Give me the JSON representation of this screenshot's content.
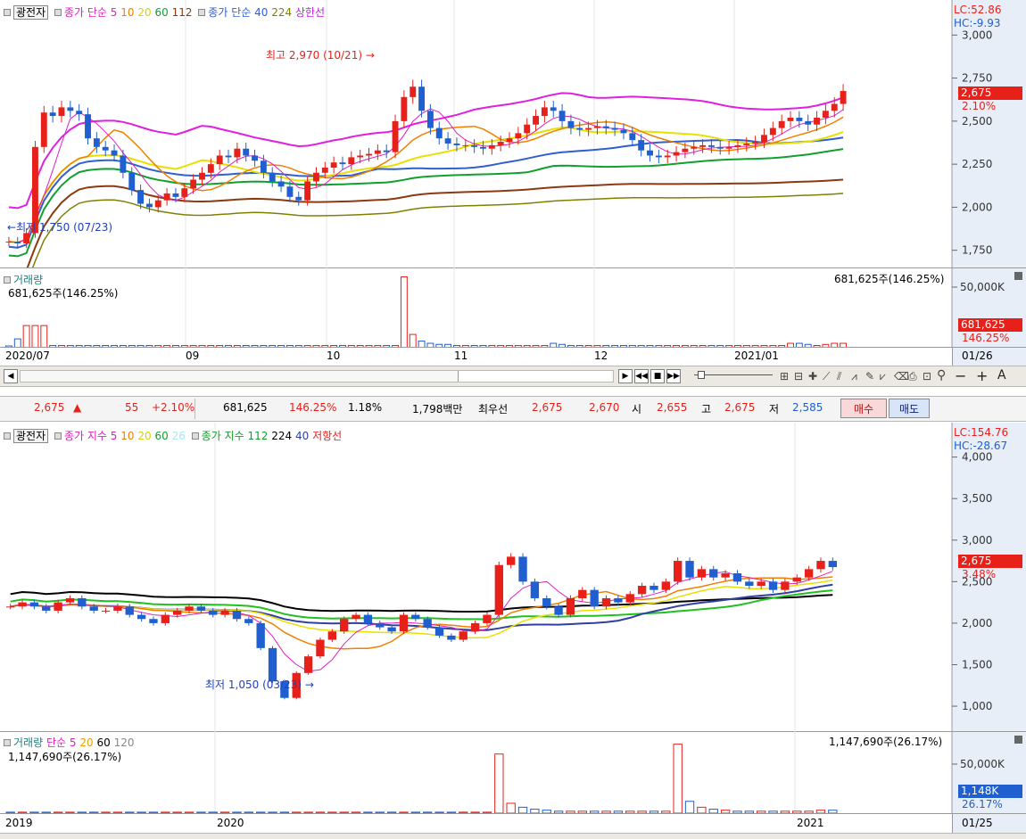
{
  "upper": {
    "stock_name": "광전자",
    "legend_close_label": "종가 단순",
    "legend_periods": [
      "5",
      "10",
      "20",
      "60",
      "112"
    ],
    "legend_close_label2": "종가 단순",
    "legend_periods2": [
      "40",
      "224"
    ],
    "legend_extra": "상한선",
    "lc": "LC:52.86",
    "hc": "HC:-9.93",
    "y_ticks": [
      "3,000",
      "2,750",
      "2,500",
      "2,250",
      "2,000",
      "1,750"
    ],
    "price_badge": "2,675",
    "pct_badge": "2.10%",
    "high_annotation": "최고 2,970 (10/21)",
    "low_annotation": "최저 1,750 (07/23)",
    "volume_title": "거래량",
    "volume_value": "681,625주(146.25%)",
    "volume_value_right": "681,625주(146.25%)",
    "vol_tick": "50,000K",
    "vol_badge": "681,625",
    "vol_pct": "146.25%",
    "x_labels": [
      "2020/07",
      "09",
      "10",
      "11",
      "12",
      "2021/01"
    ],
    "date_badge": "01/26"
  },
  "quote": {
    "price": "2,675",
    "arrow": "▲",
    "change": "55",
    "change_pct": "+2.10%",
    "volume": "681,625",
    "vol_pct": "146.25%",
    "turnover": "1.18%",
    "amount": "1,798백만",
    "best_label": "최우선",
    "ask": "2,675",
    "bid": "2,670",
    "open_label": "시",
    "open": "2,655",
    "high_label": "고",
    "high": "2,675",
    "low_label": "저",
    "low": "2,585",
    "buy": "매수",
    "sell": "매도"
  },
  "lower": {
    "stock_name": "광전자",
    "legend_label": "종가 지수",
    "legend_periods": [
      "5",
      "10",
      "20",
      "60",
      "26"
    ],
    "legend_label2": "종가 지수",
    "legend_periods2": [
      "112",
      "224",
      "40"
    ],
    "legend_extra": "저항선",
    "lc": "LC:154.76",
    "hc": "HC:-28.67",
    "y_ticks": [
      "4,000",
      "3,500",
      "3,000",
      "2,500",
      "2,000",
      "1,500",
      "1,000"
    ],
    "price_badge": "2,675",
    "pct_badge": "3.48%",
    "low_annotation": "최저 1,050 (03/23)",
    "volume_title": "거래량",
    "vol_legend_label": "단순",
    "vol_periods": [
      "5",
      "20",
      "60",
      "120"
    ],
    "volume_value": "1,147,690주(26.17%)",
    "volume_value_right": "1,147,690주(26.17%)",
    "vol_tick": "50,000K",
    "vol_badge": "1,148K",
    "vol_pct": "26.17%",
    "x_labels": [
      "2019",
      "2020",
      "2021"
    ],
    "date_badge": "01/25"
  },
  "toolbar": {
    "letter_a": "A",
    "minus": "−",
    "plus": "+"
  },
  "colors": {
    "up": "#e8201a",
    "down": "#1f5fd0",
    "ma5": "#e020c0",
    "ma10": "#f08000",
    "ma20": "#e8e000",
    "ma60": "#10a030",
    "ma112": "#8b3a10",
    "ma40": "#3060d0",
    "ma224": "#808000"
  },
  "chart_data": [
    {
      "type": "candlestick",
      "title": "광전자",
      "y_range": [
        1650,
        3100
      ],
      "x_categories": [
        "2020/07",
        "09",
        "10",
        "11",
        "12",
        "2021/01"
      ],
      "highest": {
        "value": 2970,
        "date": "10/21"
      },
      "lowest": {
        "value": 1750,
        "date": "07/23"
      },
      "last": 2675,
      "closes": [
        1800,
        1790,
        1850,
        2350,
        2550,
        2530,
        2580,
        2560,
        2540,
        2400,
        2350,
        2330,
        2300,
        2200,
        2100,
        2020,
        2000,
        2040,
        2080,
        2060,
        2110,
        2160,
        2200,
        2250,
        2300,
        2290,
        2340,
        2300,
        2270,
        2200,
        2150,
        2120,
        2060,
        2040,
        2150,
        2200,
        2230,
        2260,
        2250,
        2290,
        2300,
        2310,
        2330,
        2320,
        2500,
        2640,
        2700,
        2560,
        2460,
        2400,
        2370,
        2360,
        2360,
        2350,
        2340,
        2360,
        2380,
        2400,
        2430,
        2480,
        2530,
        2580,
        2560,
        2500,
        2460,
        2450,
        2460,
        2470,
        2460,
        2450,
        2430,
        2390,
        2330,
        2300,
        2290,
        2300,
        2320,
        2340,
        2350,
        2360,
        2350,
        2340,
        2350,
        2360,
        2370,
        2380,
        2420,
        2460,
        2500,
        2520,
        2500,
        2480,
        2520,
        2560,
        2600,
        2675
      ],
      "volumes": [
        8,
        40,
        100,
        100,
        100,
        10,
        10,
        10,
        10,
        10,
        10,
        10,
        10,
        10,
        10,
        10,
        10,
        10,
        10,
        10,
        10,
        10,
        10,
        10,
        10,
        10,
        10,
        10,
        10,
        10,
        10,
        10,
        10,
        10,
        10,
        10,
        10,
        10,
        10,
        10,
        10,
        10,
        10,
        10,
        10,
        320,
        60,
        30,
        20,
        15,
        15,
        10,
        10,
        10,
        10,
        10,
        10,
        10,
        10,
        10,
        10,
        10,
        20,
        15,
        10,
        10,
        10,
        10,
        10,
        10,
        10,
        10,
        10,
        10,
        10,
        10,
        10,
        10,
        10,
        10,
        10,
        10,
        10,
        10,
        10,
        10,
        10,
        10,
        10,
        20,
        20,
        15,
        10,
        15,
        20,
        20
      ]
    },
    {
      "type": "candlestick",
      "title": "광전자",
      "y_range": [
        700,
        4200
      ],
      "x_categories": [
        "2019",
        "2020",
        "2021"
      ],
      "lowest": {
        "value": 1050,
        "date": "03/23"
      },
      "last": 2675,
      "closes": [
        2200,
        2250,
        2200,
        2150,
        2250,
        2300,
        2200,
        2150,
        2150,
        2200,
        2100,
        2050,
        2000,
        2100,
        2150,
        2200,
        2150,
        2100,
        2150,
        2050,
        2000,
        1700,
        1300,
        1100,
        1400,
        1600,
        1800,
        1900,
        2050,
        2100,
        2000,
        1950,
        1900,
        2100,
        2050,
        1950,
        1850,
        1800,
        1900,
        2000,
        2100,
        2700,
        2800,
        2500,
        2300,
        2200,
        2100,
        2300,
        2400,
        2200,
        2300,
        2250,
        2350,
        2450,
        2400,
        2500,
        2750,
        2550,
        2650,
        2550,
        2600,
        2500,
        2450,
        2500,
        2400,
        2500,
        2550,
        2650,
        2750,
        2675
      ],
      "volumes": [
        5,
        5,
        5,
        5,
        5,
        5,
        5,
        5,
        5,
        5,
        5,
        5,
        5,
        5,
        5,
        5,
        5,
        5,
        5,
        5,
        5,
        5,
        5,
        5,
        5,
        5,
        5,
        5,
        5,
        5,
        5,
        5,
        5,
        5,
        5,
        5,
        5,
        5,
        5,
        5,
        5,
        300,
        50,
        30,
        20,
        15,
        10,
        10,
        10,
        10,
        10,
        10,
        10,
        10,
        10,
        10,
        350,
        60,
        30,
        20,
        15,
        10,
        10,
        10,
        10,
        10,
        10,
        10,
        15,
        15
      ]
    }
  ]
}
